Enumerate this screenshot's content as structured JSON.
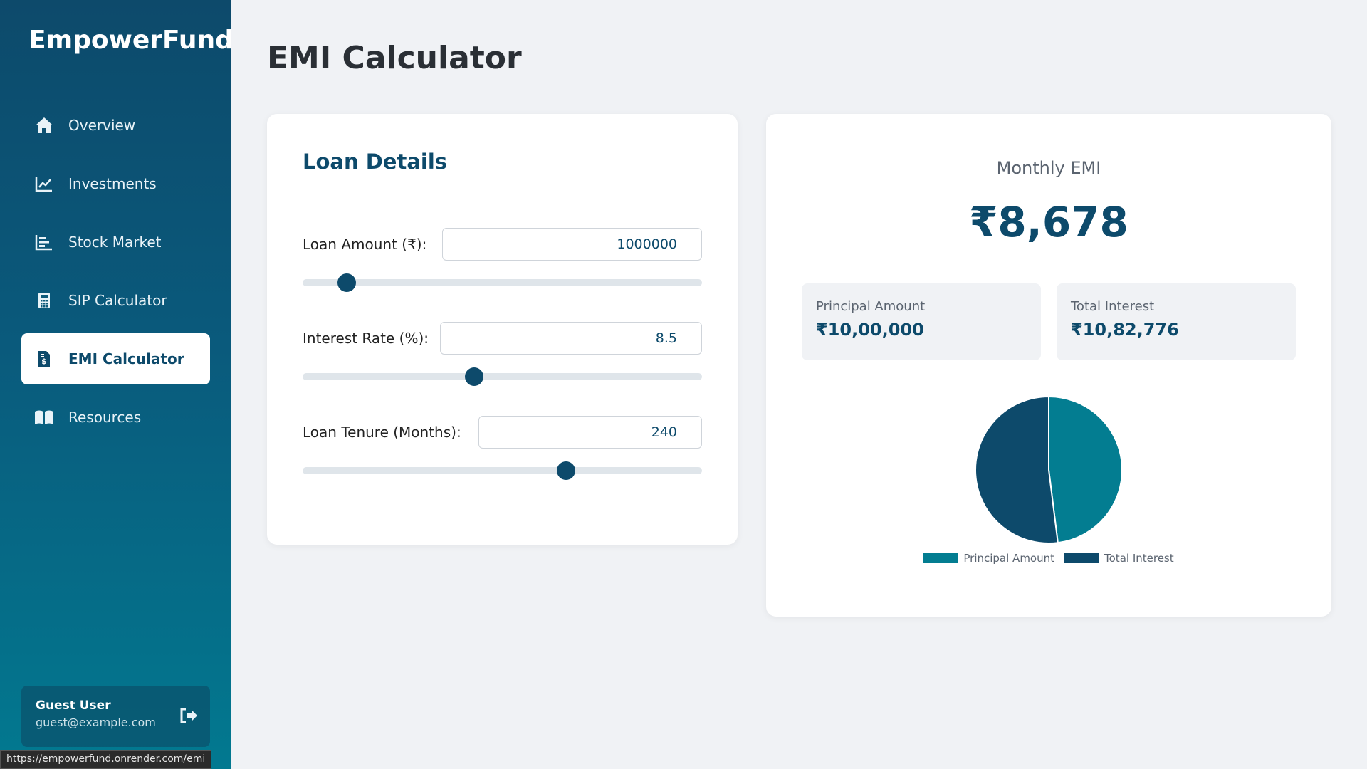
{
  "app": {
    "brand": "EmpowerFund"
  },
  "sidebar": {
    "items": [
      {
        "label": "Overview",
        "icon": "home-icon",
        "active": false
      },
      {
        "label": "Investments",
        "icon": "line-chart-icon",
        "active": false
      },
      {
        "label": "Stock Market",
        "icon": "bar-chart-icon",
        "active": false
      },
      {
        "label": "SIP Calculator",
        "icon": "calculator-icon",
        "active": false
      },
      {
        "label": "EMI Calculator",
        "icon": "invoice-dollar-icon",
        "active": true
      },
      {
        "label": "Resources",
        "icon": "book-icon",
        "active": false
      }
    ],
    "user": {
      "name": "Guest User",
      "email": "guest@example.com"
    }
  },
  "status_bar": {
    "url": "https://empowerfund.onrender.com/emi"
  },
  "page": {
    "title": "EMI Calculator"
  },
  "loan_details": {
    "heading": "Loan Details",
    "amount": {
      "label": "Loan Amount (₹):",
      "value": "1000000",
      "slider_fraction": 0.11
    },
    "rate": {
      "label": "Interest Rate (%):",
      "value": "8.5",
      "slider_fraction": 0.43
    },
    "tenure": {
      "label": "Loan Tenure (Months):",
      "value": "240",
      "slider_fraction": 0.66
    }
  },
  "result": {
    "emi_label": "Monthly EMI",
    "emi_value": "₹8,678",
    "principal_label": "Principal Amount",
    "principal_value": "₹10,00,000",
    "interest_label": "Total Interest",
    "interest_value": "₹10,82,776"
  },
  "chart_data": {
    "type": "pie",
    "labels": [
      "Principal Amount",
      "Total Interest"
    ],
    "values": [
      1000000,
      1082776
    ],
    "colors": [
      "#037d91",
      "#0d4a6b"
    ],
    "legend": "bottom"
  },
  "colors": {
    "primary": "#0d4a6b",
    "accent": "#037d91",
    "background": "#f0f2f5"
  }
}
